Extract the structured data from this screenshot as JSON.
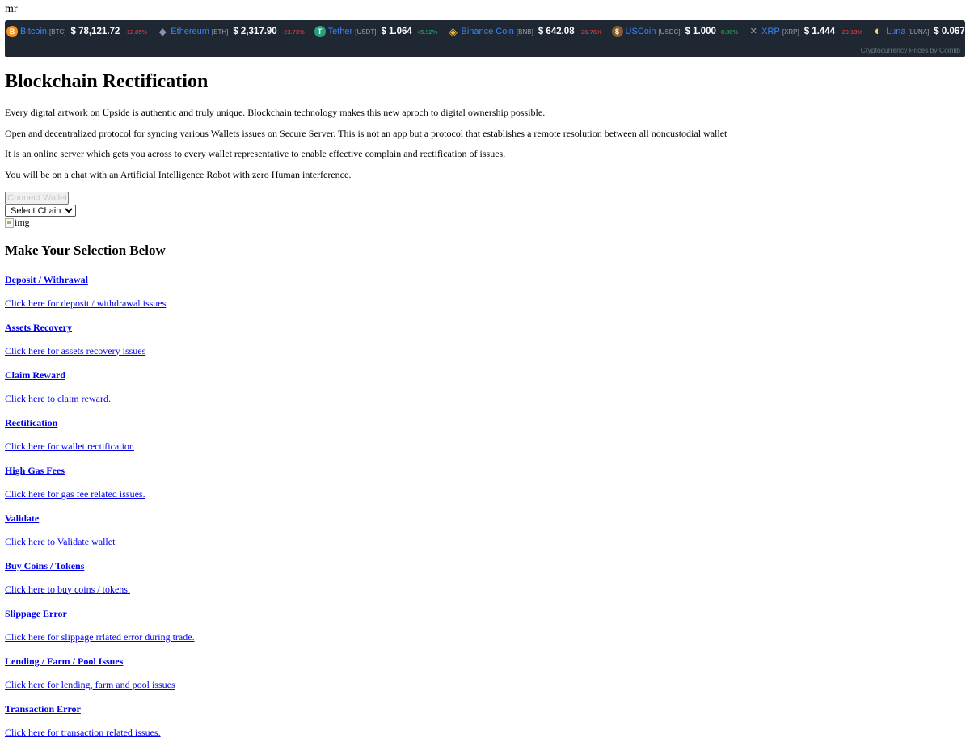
{
  "top_text": "mr",
  "ticker": {
    "coins": [
      {
        "name": "Bitcoin",
        "symbol": "[BTC]",
        "price": "$ 78,121.72",
        "change": "-12.85%",
        "direction": "neg",
        "icon": "bitcoin-icon",
        "icon_glyph": "B",
        "icon_color": "#f7931a"
      },
      {
        "name": "Ethereum",
        "symbol": "[ETH]",
        "price": "$ 2,317.90",
        "change": "-23.73%",
        "direction": "neg",
        "icon": "ethereum-icon",
        "icon_glyph": "◆",
        "icon_color": "#627eea"
      },
      {
        "name": "Tether",
        "symbol": "[USDT]",
        "price": "$ 1.064",
        "change": "+5.92%",
        "direction": "pos",
        "icon": "tether-icon",
        "icon_glyph": "T",
        "icon_color": "#26a17b"
      },
      {
        "name": "Binance Coin",
        "symbol": "[BNB]",
        "price": "$ 642.08",
        "change": "-26.76%",
        "direction": "neg",
        "icon": "binance-icon",
        "icon_glyph": "◈",
        "icon_color": "#f3ba2f"
      },
      {
        "name": "USCoin",
        "symbol": "[USDC]",
        "price": "$ 1.000",
        "change": "0.00%",
        "direction": "pos",
        "icon": "uscoin-icon",
        "icon_glyph": "$",
        "icon_color": "#8b5a2b"
      },
      {
        "name": "XRP",
        "symbol": "[XRP]",
        "price": "$ 1.444",
        "change": "-29.18%",
        "direction": "neg",
        "icon": "xrp-icon",
        "icon_glyph": "✕",
        "icon_color": "#1f2733"
      },
      {
        "name": "Luna",
        "symbol": "[LUNA]",
        "price": "$ 0.067",
        "change": "-",
        "direction": "neg",
        "icon": "luna-icon",
        "icon_glyph": "◐",
        "icon_color": "#f9d85e"
      }
    ],
    "credit": "Cryptocurrency Prices by Coinlib"
  },
  "page": {
    "title": "Blockchain Rectification",
    "paragraphs": [
      "Every digital artwork on Upside is authentic and truly unique. Blockchain technology makes this new aproch to digital ownership possible.",
      "Open and decentralized protocol for syncing various Wallets issues on Secure Server. This is not an app but a protocol that establishes a remote resolution between all noncustodial wallet",
      "It is an online server which gets you across to every wallet representative to enable effective complain and rectification of issues.",
      "You will be on a chat with an Artificial Intelligence Robot with zero Human interference."
    ],
    "connect_label": "Connect Wallet",
    "select_chain": "Select Chain",
    "img_alt": "img",
    "selection_heading": "Make Your Selection Below"
  },
  "selections": [
    {
      "title": "Deposit / Withrawal",
      "link": "Click here for deposit / withdrawal issues"
    },
    {
      "title": "Assets Recovery",
      "link": "Click here for assets recovery issues"
    },
    {
      "title": "Claim Reward",
      "link": "Click here to claim reward."
    },
    {
      "title": "Rectification",
      "link": "Click here for wallet rectification"
    },
    {
      "title": "High Gas Fees",
      "link": "Click here for gas fee related issues."
    },
    {
      "title": "Validate",
      "link": "Click here to Validate wallet"
    },
    {
      "title": "Buy Coins / Tokens",
      "link": "Click here to buy coins / tokens."
    },
    {
      "title": "Slippage Error",
      "link": "Click here for slippage rrlated error during trade."
    },
    {
      "title": "Lending / Farm / Pool Issues",
      "link": "Click here for lending, farm and pool issues"
    },
    {
      "title": "Transaction Error",
      "link": "Click here for transaction related issues."
    }
  ]
}
